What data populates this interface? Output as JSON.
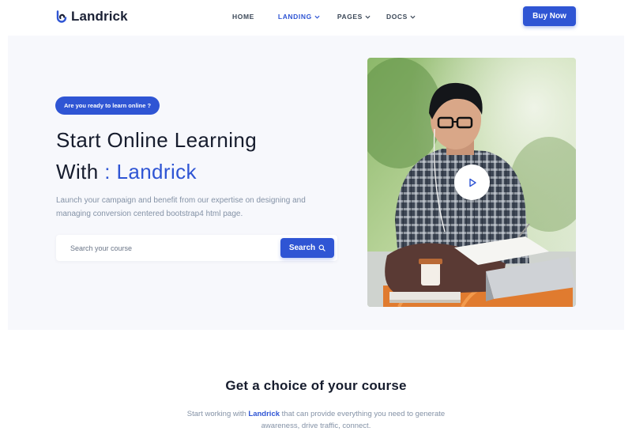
{
  "brand": {
    "name": "Landrick",
    "accent_color": "#2f55d4"
  },
  "nav": {
    "items": [
      {
        "label": "HOME",
        "has_dropdown": false,
        "active": false
      },
      {
        "label": "LANDING",
        "has_dropdown": true,
        "active": true
      },
      {
        "label": "PAGES",
        "has_dropdown": true,
        "active": false
      },
      {
        "label": "DOCS",
        "has_dropdown": true,
        "active": false
      }
    ],
    "cta_label": "Buy Now"
  },
  "hero": {
    "badge": "Are you ready to learn online ?",
    "headline_line1": "Start Online Learning",
    "headline_line2_prefix": "With",
    "headline_line2_accent": ": Landrick",
    "lead": "Launch your campaign and benefit from our expertise on designing and managing conversion centered bootstrap4 html page.",
    "search": {
      "placeholder": "Search your course",
      "button_label": "Search"
    },
    "media": {
      "play_icon": "play-icon"
    }
  },
  "courses_section": {
    "title": "Get a choice of your course",
    "subtitle_prefix": "Start working with",
    "subtitle_brand": "Landrick",
    "subtitle_suffix": "that can provide everything you need to generate awareness, drive traffic, connect."
  }
}
